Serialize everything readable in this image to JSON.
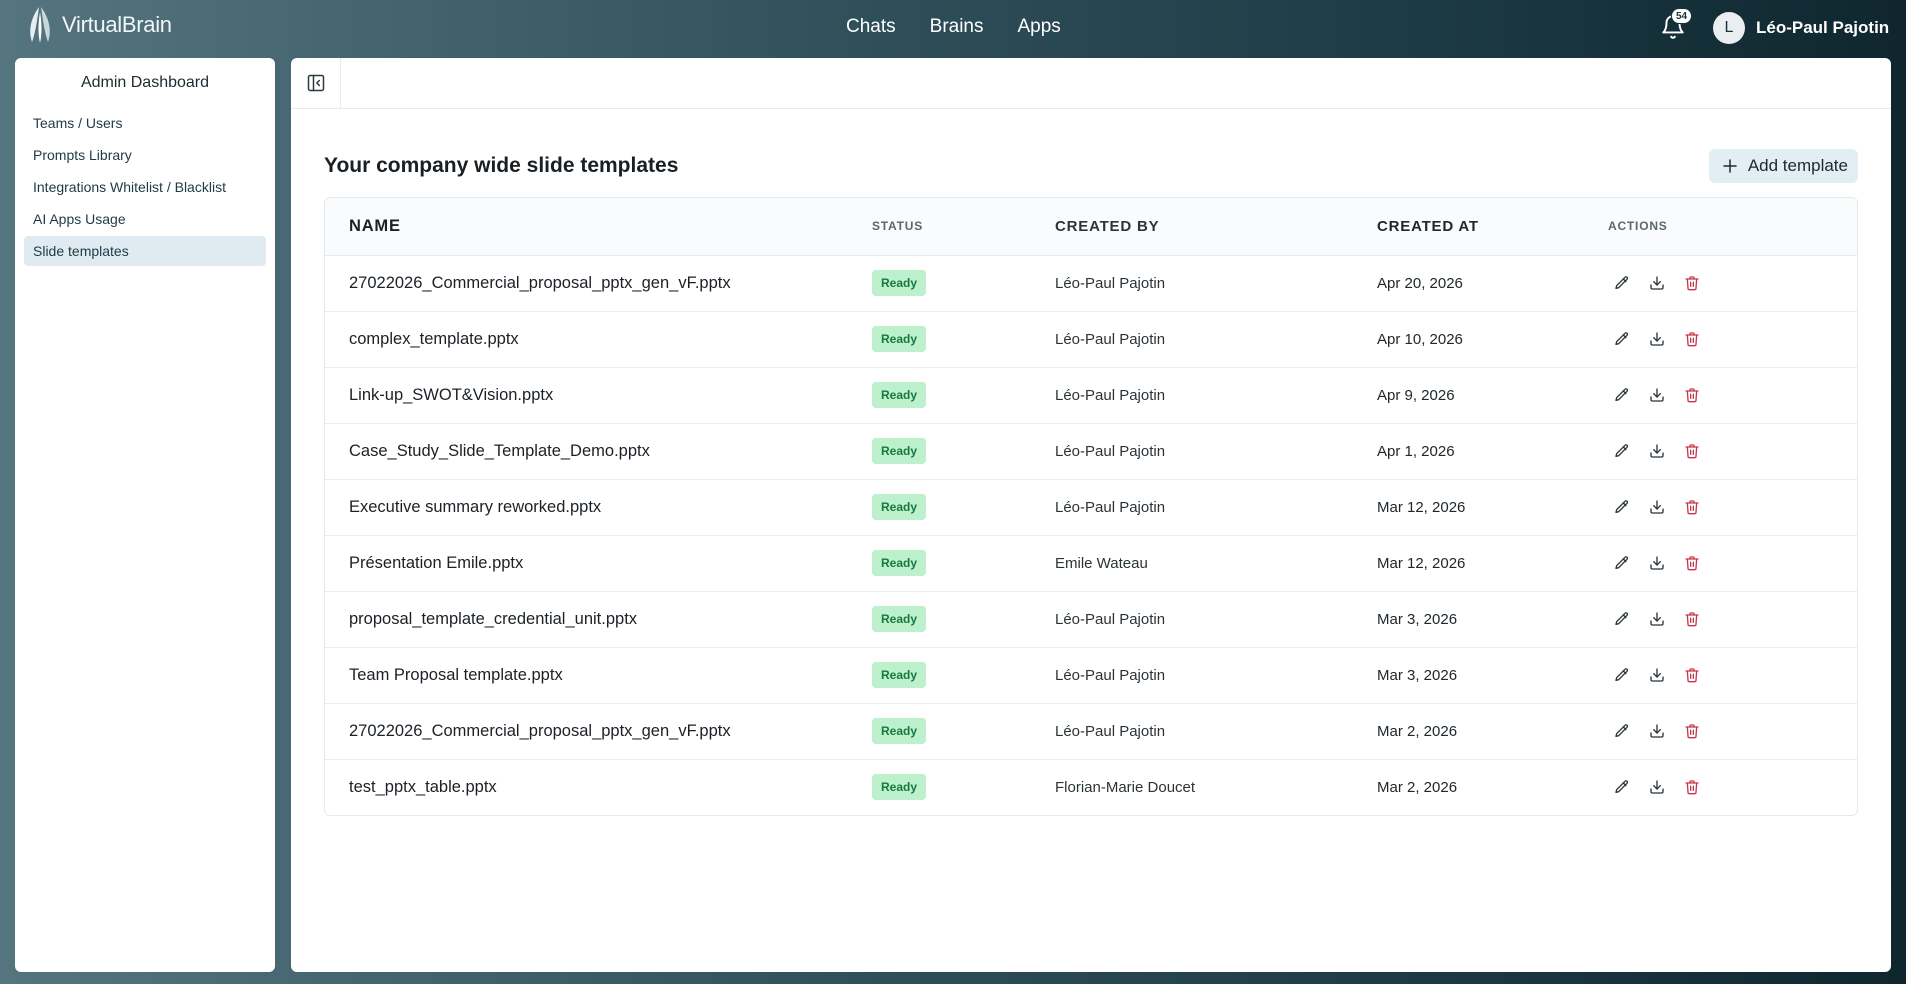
{
  "app": {
    "name": "VirtualBrain",
    "nav": [
      "Chats",
      "Brains",
      "Apps"
    ],
    "notifications_count": "54",
    "user_initial": "L",
    "user_name": "Léo-Paul Pajotin"
  },
  "sidebar": {
    "title": "Admin Dashboard",
    "items": [
      {
        "label": "Teams / Users",
        "active": false
      },
      {
        "label": "Prompts Library",
        "active": false
      },
      {
        "label": "Integrations Whitelist / Blacklist",
        "active": false
      },
      {
        "label": "AI Apps Usage",
        "active": false
      },
      {
        "label": "Slide templates",
        "active": true
      }
    ]
  },
  "main": {
    "title": "Your company wide slide templates",
    "add_button": "Add template",
    "columns": [
      "NAME",
      "STATUS",
      "CREATED BY",
      "CREATED AT",
      "ACTIONS"
    ],
    "rows": [
      {
        "name": "27022026_Commercial_proposal_pptx_gen_vF.pptx",
        "status": "Ready",
        "created_by": "Léo-Paul Pajotin",
        "created_at": "Apr 20, 2026"
      },
      {
        "name": "complex_template.pptx",
        "status": "Ready",
        "created_by": "Léo-Paul Pajotin",
        "created_at": "Apr 10, 2026"
      },
      {
        "name": "Link-up_SWOT&Vision.pptx",
        "status": "Ready",
        "created_by": "Léo-Paul Pajotin",
        "created_at": "Apr 9, 2026"
      },
      {
        "name": "Case_Study_Slide_Template_Demo.pptx",
        "status": "Ready",
        "created_by": "Léo-Paul Pajotin",
        "created_at": "Apr 1, 2026"
      },
      {
        "name": "Executive summary reworked.pptx",
        "status": "Ready",
        "created_by": "Léo-Paul Pajotin",
        "created_at": "Mar 12, 2026"
      },
      {
        "name": "Présentation Emile.pptx",
        "status": "Ready",
        "created_by": "Emile Wateau",
        "created_at": "Mar 12, 2026"
      },
      {
        "name": "proposal_template_credential_unit.pptx",
        "status": "Ready",
        "created_by": "Léo-Paul Pajotin",
        "created_at": "Mar 3, 2026"
      },
      {
        "name": "Team Proposal template.pptx",
        "status": "Ready",
        "created_by": "Léo-Paul Pajotin",
        "created_at": "Mar 3, 2026"
      },
      {
        "name": "27022026_Commercial_proposal_pptx_gen_vF.pptx",
        "status": "Ready",
        "created_by": "Léo-Paul Pajotin",
        "created_at": "Mar 2, 2026"
      },
      {
        "name": "test_pptx_table.pptx",
        "status": "Ready",
        "created_by": "Florian-Marie Doucet",
        "created_at": "Mar 2, 2026"
      }
    ],
    "row_actions": [
      "edit-icon",
      "download-icon",
      "trash-icon"
    ]
  },
  "colors": {
    "accent_light": "#dfebf1",
    "status_ready_bg": "#bdf0cc",
    "status_ready_text": "#167a3b",
    "delete_red": "#c8354b"
  }
}
